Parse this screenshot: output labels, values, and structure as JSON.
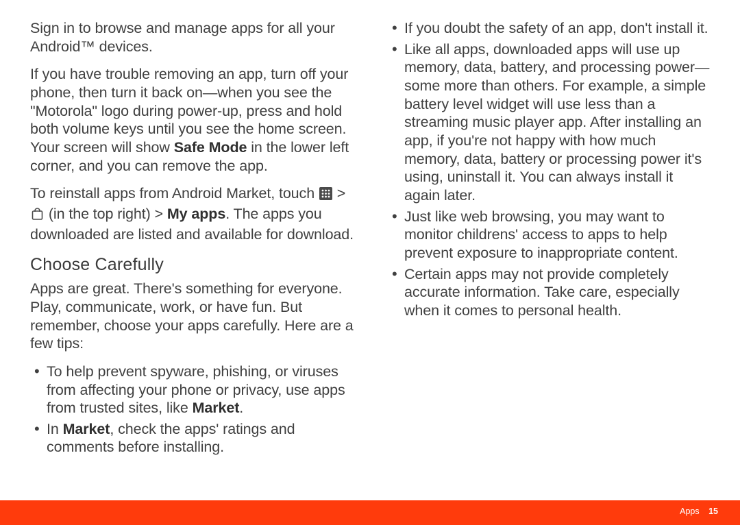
{
  "col": {
    "p1": "Sign in to browse and manage apps for all your Android™ devices.",
    "p2a": "If you have trouble removing an app, turn off your phone, then turn it back on—when you see the \"Motorola\" logo during power-up, press and hold both volume keys until you see the home screen. Your screen will show ",
    "p2_safe": "Safe Mode",
    "p2b": " in the lower left corner, and you can remove the app.",
    "p3a": "To reinstall apps from Android Market, touch ",
    "p3b": " > ",
    "p3c": " (in the top right) > ",
    "p3_myapps": "My apps",
    "p3d": ". The apps you downloaded are listed and available for download.",
    "h2": "Choose Carefully",
    "p4": "Apps are great. There's something for everyone. Play, communicate, work, or have fun. But remember, choose your apps carefully. Here are a few tips:",
    "b1a": "To help prevent spyware, phishing, or viruses from affecting your phone or privacy, use apps from trusted sites, like ",
    "b1_market": "Market",
    "b1b": ".",
    "b2a": "In ",
    "b2_market": "Market",
    "b2b": ", check the apps' ratings and comments before installing.",
    "b3": "If you doubt the safety of an app, don't install it.",
    "b4": "Like all apps, downloaded apps will use up memory, data, battery, and processing power—some more than others. For example, a simple battery level widget will use less than a streaming music player app. After installing an app, if you're not happy with how much memory, data, battery or processing power it's using, uninstall it. You can always install it again later.",
    "b5": "Just like web browsing, you may want to monitor childrens' access to apps to help prevent exposure to inappropriate content.",
    "b6": "Certain apps may not provide completely accurate information. Take care, especially when it comes to personal health."
  },
  "footer": {
    "section": "Apps",
    "page": "15"
  }
}
